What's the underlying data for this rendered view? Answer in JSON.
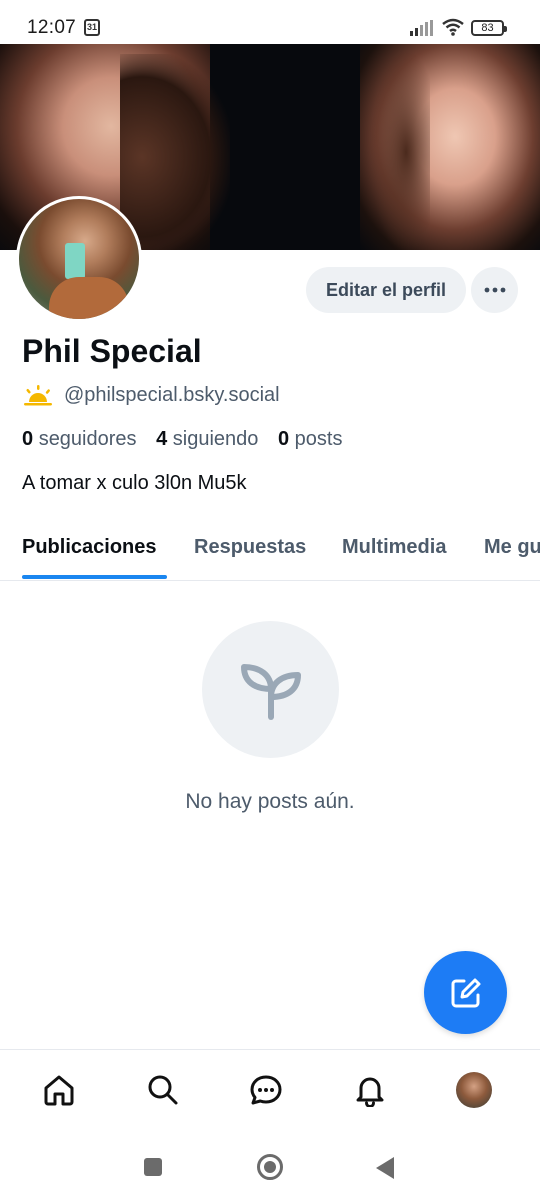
{
  "status_bar": {
    "time": "12:07",
    "calendar_day": "31",
    "battery": "83",
    "icons": [
      "calendar-icon",
      "signal-icon",
      "wifi-icon",
      "battery-icon"
    ]
  },
  "profile": {
    "edit_button": "Editar el perfil",
    "more_button_icon": "more-horizontal-icon",
    "display_name": "Phil Special",
    "handle_icon": "sun-icon",
    "handle": "@philspecial.bsky.social",
    "stats": {
      "followers_count": "0",
      "followers_label": "seguidores",
      "following_count": "4",
      "following_label": "siguiendo",
      "posts_count": "0",
      "posts_label": "posts"
    },
    "bio": "A tomar x culo 3l0n Mu5k"
  },
  "tabs": [
    {
      "label": "Publicaciones",
      "active": true
    },
    {
      "label": "Respuestas",
      "active": false
    },
    {
      "label": "Multimedia",
      "active": false
    },
    {
      "label": "Me gu",
      "active": false
    }
  ],
  "empty_state": {
    "icon": "sprout-icon",
    "text": "No hay posts aún."
  },
  "fab": {
    "icon": "compose-icon"
  },
  "bottom_nav": [
    {
      "name": "home",
      "icon": "home-icon"
    },
    {
      "name": "search",
      "icon": "search-icon"
    },
    {
      "name": "chat",
      "icon": "chat-icon"
    },
    {
      "name": "notifications",
      "icon": "bell-icon"
    },
    {
      "name": "profile",
      "icon": "avatar"
    }
  ],
  "colors": {
    "accent": "#1d7cf5",
    "tab_underline": "#1a86f0",
    "muted_text": "#4d5b6b",
    "button_bg": "#eef1f4"
  }
}
